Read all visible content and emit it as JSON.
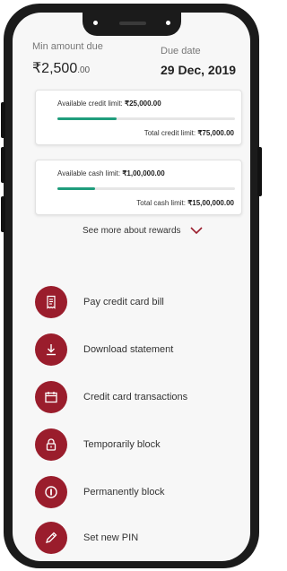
{
  "summary": {
    "min_amount_label": "Min amount due",
    "min_amount_main": "₹2,500",
    "min_amount_decimal": ".00",
    "due_date_label": "Due date",
    "due_date_value": "29 Dec, 2019"
  },
  "credit_card": {
    "available_label": "Available credit limit: ",
    "available_value": "₹25,000.00",
    "total_label": "Total credit limit: ",
    "total_value": "₹75,000.00",
    "used_fraction": 0.333
  },
  "cash_card": {
    "available_label": "Available cash limit: ",
    "available_value": "₹1,00,000.00",
    "total_label": "Total cash limit: ",
    "total_value": "₹15,00,000.00",
    "used_fraction": 0.213
  },
  "rewards": {
    "label": "See more about rewards"
  },
  "actions": [
    {
      "label": "Pay credit card bill",
      "icon": "receipt-icon"
    },
    {
      "label": "Download statement",
      "icon": "download-icon"
    },
    {
      "label": "Credit card transactions",
      "icon": "calendar-icon"
    },
    {
      "label": "Temporarily block",
      "icon": "lock-icon"
    },
    {
      "label": "Permanently block",
      "icon": "block-icon"
    },
    {
      "label": "Set new PIN",
      "icon": "pencil-icon"
    }
  ],
  "colors": {
    "accent": "#9a1d2c",
    "progress": "#1f9d7c"
  }
}
